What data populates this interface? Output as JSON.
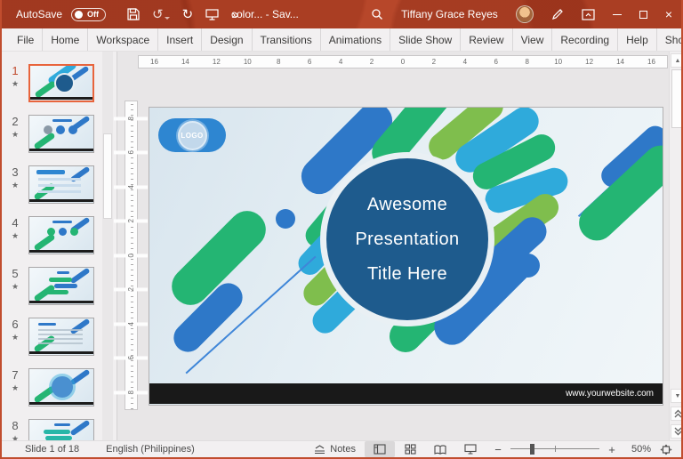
{
  "colors": {
    "titlebar_red": "#B7472A",
    "selection_orange": "#E8643C",
    "shape_blue": "#2E78C8",
    "shape_green": "#24B573",
    "shape_cyan": "#2FAADB",
    "shape_light_green": "#7FBE4D",
    "title_circle_blue": "#1E5B8D",
    "logo_blue": "#2E86D1",
    "website_bar_black": "#191919"
  },
  "titlebar": {
    "autosave_label": "AutoSave",
    "autosave_state": "Off",
    "undo_glyph": "↺",
    "redo_glyph": "↻",
    "more_glyph": "»",
    "doc_title": "color...  -  Sav...",
    "user_name": "Tiffany Grace Reyes",
    "close_glyph": "×"
  },
  "ribbon": {
    "tabs": [
      "File",
      "Home",
      "Workspace",
      "Insert",
      "Design",
      "Transitions",
      "Animations",
      "Slide Show",
      "Review",
      "View",
      "Recording",
      "Help",
      "ShortcutTo"
    ]
  },
  "panel": {
    "thumbnails": [
      {
        "num": "1",
        "star": "★",
        "variant": "v-title",
        "state": "selected"
      },
      {
        "num": "2",
        "star": "★",
        "variant": "v-services"
      },
      {
        "num": "3",
        "star": "★",
        "variant": "v-header"
      },
      {
        "num": "4",
        "star": "★",
        "variant": "v-icons"
      },
      {
        "num": "5",
        "star": "★",
        "variant": "v-chat"
      },
      {
        "num": "6",
        "star": "★",
        "variant": "v-text"
      },
      {
        "num": "7",
        "star": "★",
        "variant": "v-cluster"
      },
      {
        "num": "8",
        "star": "★",
        "variant": "v-pills"
      }
    ]
  },
  "rulers": {
    "h": [
      "16",
      "14",
      "12",
      "10",
      "8",
      "6",
      "4",
      "2",
      "0",
      "2",
      "4",
      "6",
      "8",
      "10",
      "12",
      "14",
      "16"
    ],
    "v": [
      "8",
      "6",
      "4",
      "2",
      "0",
      "2",
      "4",
      "6",
      "8"
    ]
  },
  "slide": {
    "logo_text": "LOGO",
    "title_lines": [
      "Awesome",
      "Presentation",
      "Title Here"
    ],
    "website": "www.yourwebsite.com"
  },
  "statusbar": {
    "slide_indicator": "Slide 1 of 18",
    "language": "English (Philippines)",
    "notes_label": "Notes",
    "zoom_minus": "−",
    "zoom_plus": "+",
    "zoom_level": "50%"
  }
}
